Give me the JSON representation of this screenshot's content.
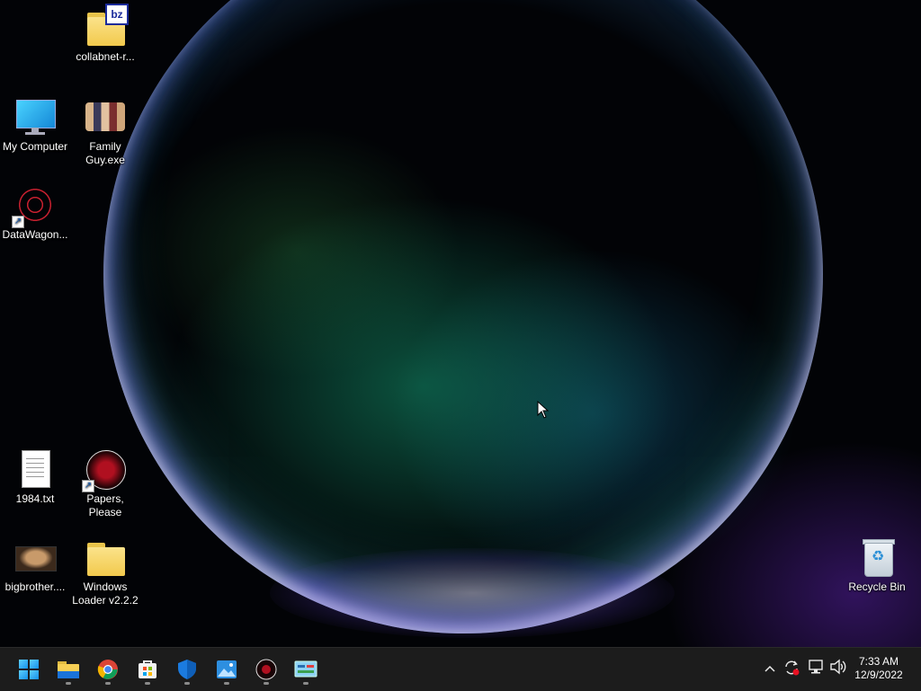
{
  "desktop": {
    "icons": [
      {
        "id": "collabnet",
        "label": "collabnet-r..."
      },
      {
        "id": "my-computer",
        "label": "My Computer"
      },
      {
        "id": "family-guy",
        "label": "Family Guy.exe"
      },
      {
        "id": "datawagon",
        "label": "DataWagon..."
      },
      {
        "id": "1984",
        "label": "1984.txt"
      },
      {
        "id": "papers-please",
        "label": "Papers, Please"
      },
      {
        "id": "bigbrother",
        "label": "bigbrother...."
      },
      {
        "id": "windows-loader",
        "label": "Windows Loader v2.2.2"
      },
      {
        "id": "recycle-bin",
        "label": "Recycle Bin"
      }
    ],
    "badge_text": "bz"
  },
  "taskbar": {
    "apps": [
      {
        "name": "start",
        "icon": "windows-logo-icon"
      },
      {
        "name": "file-explorer",
        "icon": "folder-icon"
      },
      {
        "name": "chrome",
        "icon": "chrome-icon"
      },
      {
        "name": "store",
        "icon": "store-icon"
      },
      {
        "name": "defender",
        "icon": "shield-icon"
      },
      {
        "name": "photos",
        "icon": "photos-icon"
      },
      {
        "name": "papers-please",
        "icon": "papers-please-icon"
      },
      {
        "name": "control-panel",
        "icon": "control-panel-icon"
      }
    ],
    "tray": {
      "icons": [
        "chevron-up-icon",
        "sync-alert-icon",
        "network-icon",
        "volume-icon"
      ],
      "time": "7:33 AM",
      "date": "12/9/2022"
    }
  }
}
